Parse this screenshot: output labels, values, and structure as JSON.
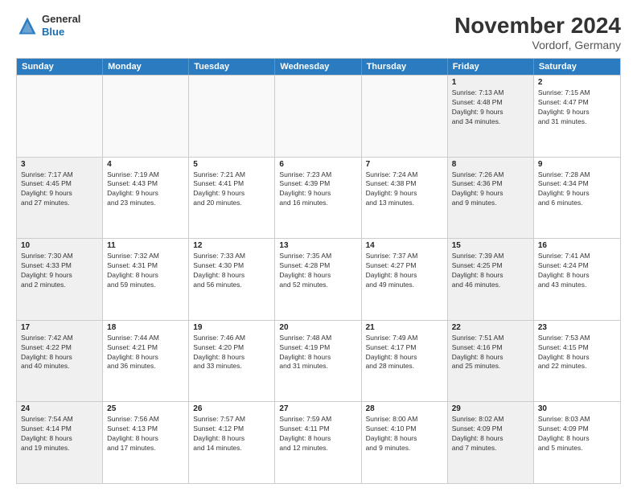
{
  "header": {
    "title": "November 2024",
    "location": "Vordorf, Germany",
    "logo_general": "General",
    "logo_blue": "Blue"
  },
  "weekdays": [
    "Sunday",
    "Monday",
    "Tuesday",
    "Wednesday",
    "Thursday",
    "Friday",
    "Saturday"
  ],
  "rows": [
    [
      {
        "day": "",
        "info": "",
        "empty": true
      },
      {
        "day": "",
        "info": "",
        "empty": true
      },
      {
        "day": "",
        "info": "",
        "empty": true
      },
      {
        "day": "",
        "info": "",
        "empty": true
      },
      {
        "day": "",
        "info": "",
        "empty": true
      },
      {
        "day": "1",
        "info": "Sunrise: 7:13 AM\nSunset: 4:48 PM\nDaylight: 9 hours\nand 34 minutes.",
        "shaded": true
      },
      {
        "day": "2",
        "info": "Sunrise: 7:15 AM\nSunset: 4:47 PM\nDaylight: 9 hours\nand 31 minutes."
      }
    ],
    [
      {
        "day": "3",
        "info": "Sunrise: 7:17 AM\nSunset: 4:45 PM\nDaylight: 9 hours\nand 27 minutes.",
        "shaded": true
      },
      {
        "day": "4",
        "info": "Sunrise: 7:19 AM\nSunset: 4:43 PM\nDaylight: 9 hours\nand 23 minutes."
      },
      {
        "day": "5",
        "info": "Sunrise: 7:21 AM\nSunset: 4:41 PM\nDaylight: 9 hours\nand 20 minutes."
      },
      {
        "day": "6",
        "info": "Sunrise: 7:23 AM\nSunset: 4:39 PM\nDaylight: 9 hours\nand 16 minutes."
      },
      {
        "day": "7",
        "info": "Sunrise: 7:24 AM\nSunset: 4:38 PM\nDaylight: 9 hours\nand 13 minutes."
      },
      {
        "day": "8",
        "info": "Sunrise: 7:26 AM\nSunset: 4:36 PM\nDaylight: 9 hours\nand 9 minutes.",
        "shaded": true
      },
      {
        "day": "9",
        "info": "Sunrise: 7:28 AM\nSunset: 4:34 PM\nDaylight: 9 hours\nand 6 minutes."
      }
    ],
    [
      {
        "day": "10",
        "info": "Sunrise: 7:30 AM\nSunset: 4:33 PM\nDaylight: 9 hours\nand 2 minutes.",
        "shaded": true
      },
      {
        "day": "11",
        "info": "Sunrise: 7:32 AM\nSunset: 4:31 PM\nDaylight: 8 hours\nand 59 minutes."
      },
      {
        "day": "12",
        "info": "Sunrise: 7:33 AM\nSunset: 4:30 PM\nDaylight: 8 hours\nand 56 minutes."
      },
      {
        "day": "13",
        "info": "Sunrise: 7:35 AM\nSunset: 4:28 PM\nDaylight: 8 hours\nand 52 minutes."
      },
      {
        "day": "14",
        "info": "Sunrise: 7:37 AM\nSunset: 4:27 PM\nDaylight: 8 hours\nand 49 minutes."
      },
      {
        "day": "15",
        "info": "Sunrise: 7:39 AM\nSunset: 4:25 PM\nDaylight: 8 hours\nand 46 minutes.",
        "shaded": true
      },
      {
        "day": "16",
        "info": "Sunrise: 7:41 AM\nSunset: 4:24 PM\nDaylight: 8 hours\nand 43 minutes."
      }
    ],
    [
      {
        "day": "17",
        "info": "Sunrise: 7:42 AM\nSunset: 4:22 PM\nDaylight: 8 hours\nand 40 minutes.",
        "shaded": true
      },
      {
        "day": "18",
        "info": "Sunrise: 7:44 AM\nSunset: 4:21 PM\nDaylight: 8 hours\nand 36 minutes."
      },
      {
        "day": "19",
        "info": "Sunrise: 7:46 AM\nSunset: 4:20 PM\nDaylight: 8 hours\nand 33 minutes."
      },
      {
        "day": "20",
        "info": "Sunrise: 7:48 AM\nSunset: 4:19 PM\nDaylight: 8 hours\nand 31 minutes."
      },
      {
        "day": "21",
        "info": "Sunrise: 7:49 AM\nSunset: 4:17 PM\nDaylight: 8 hours\nand 28 minutes."
      },
      {
        "day": "22",
        "info": "Sunrise: 7:51 AM\nSunset: 4:16 PM\nDaylight: 8 hours\nand 25 minutes.",
        "shaded": true
      },
      {
        "day": "23",
        "info": "Sunrise: 7:53 AM\nSunset: 4:15 PM\nDaylight: 8 hours\nand 22 minutes."
      }
    ],
    [
      {
        "day": "24",
        "info": "Sunrise: 7:54 AM\nSunset: 4:14 PM\nDaylight: 8 hours\nand 19 minutes.",
        "shaded": true
      },
      {
        "day": "25",
        "info": "Sunrise: 7:56 AM\nSunset: 4:13 PM\nDaylight: 8 hours\nand 17 minutes."
      },
      {
        "day": "26",
        "info": "Sunrise: 7:57 AM\nSunset: 4:12 PM\nDaylight: 8 hours\nand 14 minutes."
      },
      {
        "day": "27",
        "info": "Sunrise: 7:59 AM\nSunset: 4:11 PM\nDaylight: 8 hours\nand 12 minutes."
      },
      {
        "day": "28",
        "info": "Sunrise: 8:00 AM\nSunset: 4:10 PM\nDaylight: 8 hours\nand 9 minutes."
      },
      {
        "day": "29",
        "info": "Sunrise: 8:02 AM\nSunset: 4:09 PM\nDaylight: 8 hours\nand 7 minutes.",
        "shaded": true
      },
      {
        "day": "30",
        "info": "Sunrise: 8:03 AM\nSunset: 4:09 PM\nDaylight: 8 hours\nand 5 minutes."
      }
    ]
  ]
}
